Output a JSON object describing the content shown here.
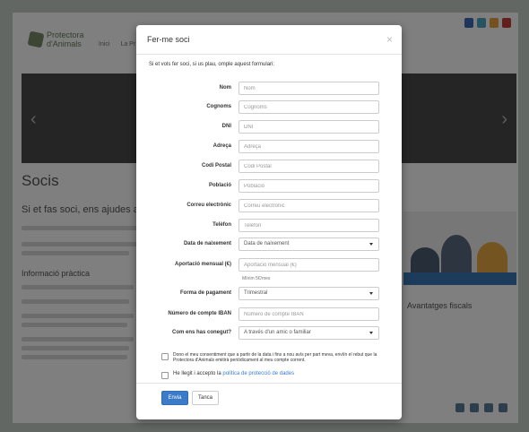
{
  "background": {
    "logo_line1": "Protectora",
    "logo_line2": "d'Animals",
    "nav": [
      "Inici",
      "La Pr"
    ],
    "top_buttons": [
      {
        "label": "",
        "color": "#3a6db3"
      },
      {
        "label": "",
        "color": "#4fa6c4"
      },
      {
        "label": "",
        "color": "#e9a33a"
      },
      {
        "label": "",
        "color": "#c4403a"
      }
    ],
    "page_title": "Socis",
    "lead": "Si et fas soci, ens ajudes a m",
    "section_heading": "Informació pràctica",
    "sidebar_heading": "Avantatges fiscals"
  },
  "modal": {
    "title": "Fer-me soci",
    "close_symbol": "×",
    "intro": "Si et vols fer soci, si us plau, omple aquest formulari:",
    "fields": [
      {
        "label": "Nom",
        "placeholder": "Nom"
      },
      {
        "label": "Cognoms",
        "placeholder": "Cognoms"
      },
      {
        "label": "DNI",
        "placeholder": "DNI"
      },
      {
        "label": "Adreça",
        "placeholder": "Adreça"
      },
      {
        "label": "Codi Postal",
        "placeholder": "Codi Postal"
      },
      {
        "label": "Població",
        "placeholder": "Població"
      },
      {
        "label": "Correu electrònic",
        "placeholder": "Correu electrònic"
      },
      {
        "label": "Telèfon",
        "placeholder": "Telèfon"
      },
      {
        "label": "Data de naixement",
        "value": "Data de naixement"
      },
      {
        "label": "Aportació mensual (€)",
        "placeholder": "Aportació mensual (€)"
      },
      {
        "label": "Forma de pagament",
        "value": "Trimestral"
      },
      {
        "label": "Número de compte IBAN",
        "placeholder": "Número de compte IBAN"
      },
      {
        "label": "Com ens has conegut?",
        "value": "A través d'un amic o familiar"
      }
    ],
    "help_minimum": "Mínim 5€/mes",
    "consent_text": "Dono el meu consentiment que a partir de la data i fins a nou avís per part meva, envíïn el rebut que la Protectora d'Animals emitirà periòdicament al meu compte corrent.",
    "privacy_prefix": "He llegit i accepto la",
    "privacy_link": "política de protecció de dades",
    "submit_label": "Envia",
    "close_label": "Tanca"
  }
}
